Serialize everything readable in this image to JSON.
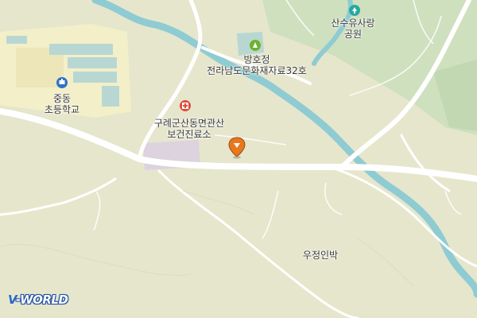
{
  "map": {
    "colors": {
      "land": "#e6e6cd",
      "park": "#cfe0bf",
      "river": "#8fcbd3",
      "road": "#ffffff",
      "building": "#b9d7d2",
      "school_area": "#f3efc9",
      "clinic_area": "#dcd3df"
    },
    "labels": {
      "school_name": "중동\n초등학교",
      "clinic_name": "구례군산동면관산\n보건진료소",
      "monument_name": "방호정\n전라남도문화재자료32호",
      "park_name": "산수유사랑\n공원",
      "inn_name": "우정인박"
    },
    "icons": {
      "school": "school-icon",
      "clinic": "hospital-icon",
      "monument": "monument-icon",
      "park": "park-icon",
      "location_pin": "location-pin-icon"
    },
    "brand": {
      "v": "V",
      "rest": "-WORLD"
    }
  }
}
